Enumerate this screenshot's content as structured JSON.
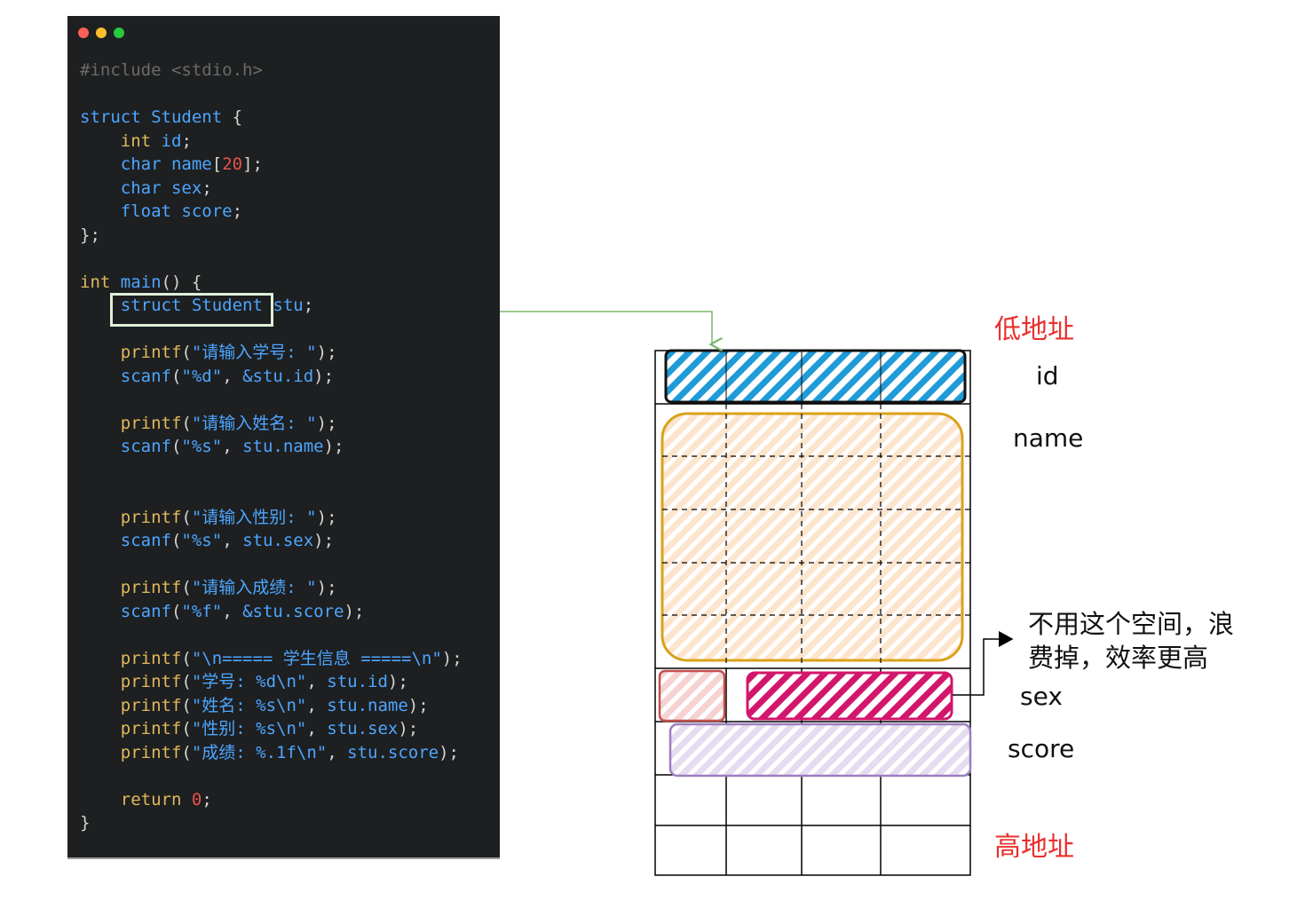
{
  "code_window": {
    "lines": [
      [
        {
          "c": "comment",
          "t": "#include <stdio.h>"
        }
      ],
      [],
      [
        {
          "c": "kw",
          "t": "struct"
        },
        {
          "c": "plain",
          "t": " "
        },
        {
          "c": "kw",
          "t": "Student"
        },
        {
          "c": "plain",
          "t": " {"
        }
      ],
      [
        {
          "c": "plain",
          "t": "    "
        },
        {
          "c": "fn",
          "t": "int"
        },
        {
          "c": "plain",
          "t": " "
        },
        {
          "c": "kw",
          "t": "id"
        },
        {
          "c": "plain",
          "t": ";"
        }
      ],
      [
        {
          "c": "plain",
          "t": "    "
        },
        {
          "c": "kw",
          "t": "char"
        },
        {
          "c": "plain",
          "t": " "
        },
        {
          "c": "kw",
          "t": "name"
        },
        {
          "c": "plain",
          "t": "["
        },
        {
          "c": "num",
          "t": "20"
        },
        {
          "c": "plain",
          "t": "];"
        }
      ],
      [
        {
          "c": "plain",
          "t": "    "
        },
        {
          "c": "kw",
          "t": "char"
        },
        {
          "c": "plain",
          "t": " "
        },
        {
          "c": "kw",
          "t": "sex"
        },
        {
          "c": "plain",
          "t": ";"
        }
      ],
      [
        {
          "c": "plain",
          "t": "    "
        },
        {
          "c": "kw",
          "t": "float"
        },
        {
          "c": "plain",
          "t": " "
        },
        {
          "c": "kw",
          "t": "score"
        },
        {
          "c": "plain",
          "t": ";"
        }
      ],
      [
        {
          "c": "plain",
          "t": "};"
        }
      ],
      [],
      [
        {
          "c": "fn",
          "t": "int"
        },
        {
          "c": "plain",
          "t": " "
        },
        {
          "c": "kw",
          "t": "main"
        },
        {
          "c": "plain",
          "t": "() {"
        }
      ],
      [
        {
          "c": "plain",
          "t": "    "
        },
        {
          "c": "kw",
          "t": "struct"
        },
        {
          "c": "plain",
          "t": " "
        },
        {
          "c": "kw",
          "t": "Student"
        },
        {
          "c": "plain",
          "t": " "
        },
        {
          "c": "kw",
          "t": "stu"
        },
        {
          "c": "plain",
          "t": ";"
        }
      ],
      [],
      [
        {
          "c": "plain",
          "t": "    "
        },
        {
          "c": "fn",
          "t": "printf"
        },
        {
          "c": "plain",
          "t": "("
        },
        {
          "c": "str",
          "t": "\"请输入学号: \""
        },
        {
          "c": "plain",
          "t": ");"
        }
      ],
      [
        {
          "c": "plain",
          "t": "    "
        },
        {
          "c": "kw",
          "t": "scanf"
        },
        {
          "c": "plain",
          "t": "("
        },
        {
          "c": "str",
          "t": "\"%d\""
        },
        {
          "c": "plain",
          "t": ", "
        },
        {
          "c": "kw",
          "t": "&stu.id"
        },
        {
          "c": "plain",
          "t": ");"
        }
      ],
      [],
      [
        {
          "c": "plain",
          "t": "    "
        },
        {
          "c": "fn",
          "t": "printf"
        },
        {
          "c": "plain",
          "t": "("
        },
        {
          "c": "str",
          "t": "\"请输入姓名: \""
        },
        {
          "c": "plain",
          "t": ");"
        }
      ],
      [
        {
          "c": "plain",
          "t": "    "
        },
        {
          "c": "kw",
          "t": "scanf"
        },
        {
          "c": "plain",
          "t": "("
        },
        {
          "c": "str",
          "t": "\"%s\""
        },
        {
          "c": "plain",
          "t": ", "
        },
        {
          "c": "kw",
          "t": "stu.name"
        },
        {
          "c": "plain",
          "t": ");"
        }
      ],
      [],
      [],
      [
        {
          "c": "plain",
          "t": "    "
        },
        {
          "c": "fn",
          "t": "printf"
        },
        {
          "c": "plain",
          "t": "("
        },
        {
          "c": "str",
          "t": "\"请输入性别: \""
        },
        {
          "c": "plain",
          "t": ");"
        }
      ],
      [
        {
          "c": "plain",
          "t": "    "
        },
        {
          "c": "kw",
          "t": "scanf"
        },
        {
          "c": "plain",
          "t": "("
        },
        {
          "c": "str",
          "t": "\"%s\""
        },
        {
          "c": "plain",
          "t": ", "
        },
        {
          "c": "kw",
          "t": "stu.sex"
        },
        {
          "c": "plain",
          "t": ");"
        }
      ],
      [],
      [
        {
          "c": "plain",
          "t": "    "
        },
        {
          "c": "fn",
          "t": "printf"
        },
        {
          "c": "plain",
          "t": "("
        },
        {
          "c": "str",
          "t": "\"请输入成绩: \""
        },
        {
          "c": "plain",
          "t": ");"
        }
      ],
      [
        {
          "c": "plain",
          "t": "    "
        },
        {
          "c": "kw",
          "t": "scanf"
        },
        {
          "c": "plain",
          "t": "("
        },
        {
          "c": "str",
          "t": "\"%f\""
        },
        {
          "c": "plain",
          "t": ", "
        },
        {
          "c": "kw",
          "t": "&stu.score"
        },
        {
          "c": "plain",
          "t": ");"
        }
      ],
      [],
      [
        {
          "c": "plain",
          "t": "    "
        },
        {
          "c": "fn",
          "t": "printf"
        },
        {
          "c": "plain",
          "t": "("
        },
        {
          "c": "str",
          "t": "\"\\n===== 学生信息 =====\\n\""
        },
        {
          "c": "plain",
          "t": ");"
        }
      ],
      [
        {
          "c": "plain",
          "t": "    "
        },
        {
          "c": "fn",
          "t": "printf"
        },
        {
          "c": "plain",
          "t": "("
        },
        {
          "c": "str",
          "t": "\"学号: %d\\n\""
        },
        {
          "c": "plain",
          "t": ", "
        },
        {
          "c": "kw",
          "t": "stu.id"
        },
        {
          "c": "plain",
          "t": ");"
        }
      ],
      [
        {
          "c": "plain",
          "t": "    "
        },
        {
          "c": "fn",
          "t": "printf"
        },
        {
          "c": "plain",
          "t": "("
        },
        {
          "c": "str",
          "t": "\"姓名: %s\\n\""
        },
        {
          "c": "plain",
          "t": ", "
        },
        {
          "c": "kw",
          "t": "stu.name"
        },
        {
          "c": "plain",
          "t": ");"
        }
      ],
      [
        {
          "c": "plain",
          "t": "    "
        },
        {
          "c": "fn",
          "t": "printf"
        },
        {
          "c": "plain",
          "t": "("
        },
        {
          "c": "str",
          "t": "\"性别: %s\\n\""
        },
        {
          "c": "plain",
          "t": ", "
        },
        {
          "c": "kw",
          "t": "stu.sex"
        },
        {
          "c": "plain",
          "t": ");"
        }
      ],
      [
        {
          "c": "plain",
          "t": "    "
        },
        {
          "c": "fn",
          "t": "printf"
        },
        {
          "c": "plain",
          "t": "("
        },
        {
          "c": "str",
          "t": "\"成绩: %.1f\\n\""
        },
        {
          "c": "plain",
          "t": ", "
        },
        {
          "c": "kw",
          "t": "stu.score"
        },
        {
          "c": "plain",
          "t": ");"
        }
      ],
      [],
      [
        {
          "c": "plain",
          "t": "    "
        },
        {
          "c": "fn",
          "t": "return"
        },
        {
          "c": "plain",
          "t": " "
        },
        {
          "c": "num",
          "t": "0"
        },
        {
          "c": "plain",
          "t": ";"
        }
      ],
      [
        {
          "c": "plain",
          "t": "}"
        }
      ]
    ]
  },
  "memory_diagram": {
    "low_address": "低地址",
    "high_address": "高地址",
    "fields": {
      "id": "id",
      "name": "name",
      "sex": "sex",
      "score": "score"
    },
    "padding_note": "不用这个空间，浪费掉，效率更高",
    "colors": {
      "id": "#1f9bd7",
      "name": "#f5c48f",
      "name_border": "#d9a21a",
      "padding": "#e8a8a6",
      "padding_border": "#c0504d",
      "sex": "#d2166b",
      "score": "#c8b4dc",
      "score_border": "#9b7fbe",
      "arrow": "#7cb86a",
      "address_label": "#e8302e"
    }
  }
}
